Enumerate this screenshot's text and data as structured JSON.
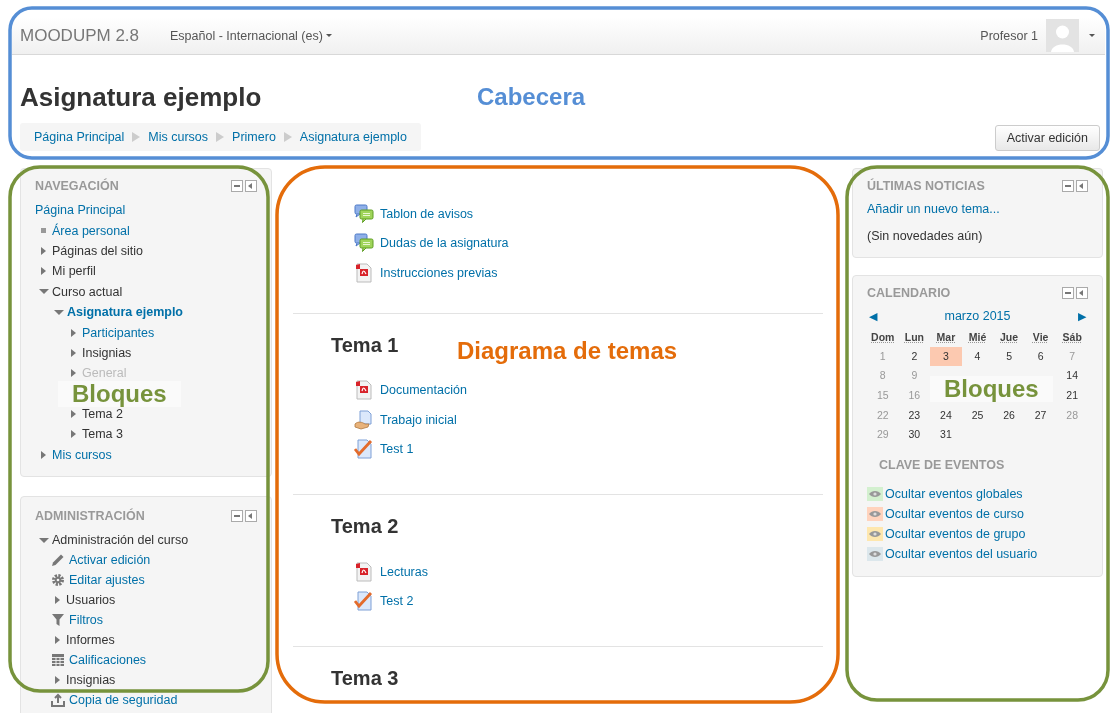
{
  "header": {
    "brand": "MOODUPM 2.8",
    "language": "Español - Internacional (es)",
    "user": "Profesor 1"
  },
  "page_title": "Asignatura ejemplo",
  "breadcrumb": [
    "Página Principal",
    "Mis cursos",
    "Primero",
    "Asignatura ejemplo"
  ],
  "edit_button": "Activar edición",
  "navigation": {
    "title": "NAVEGACIÓN",
    "items": [
      {
        "label": "Página Principal",
        "kind": "plain",
        "link": true,
        "dimmed": false,
        "current": false
      },
      {
        "label": "Área personal",
        "kind": "leaf",
        "link": true,
        "dimmed": false,
        "current": false
      },
      {
        "label": "Páginas del sitio",
        "kind": "branch",
        "expanded": false,
        "link": false,
        "dimmed": false,
        "current": false
      },
      {
        "label": "Mi perfil",
        "kind": "branch",
        "expanded": false,
        "link": false,
        "dimmed": false,
        "current": false
      },
      {
        "label": "Curso actual",
        "kind": "branch",
        "expanded": true,
        "link": false,
        "dimmed": false,
        "current": false,
        "children": [
          {
            "label": "Asignatura ejemplo",
            "kind": "branch",
            "expanded": true,
            "link": true,
            "dimmed": false,
            "current": true,
            "children": [
              {
                "label": "Participantes",
                "kind": "branch",
                "expanded": false,
                "link": true,
                "dimmed": false,
                "current": false
              },
              {
                "label": "Insignias",
                "kind": "branch",
                "expanded": false,
                "link": false,
                "dimmed": false,
                "current": false
              },
              {
                "label": "General",
                "kind": "branch",
                "expanded": false,
                "link": false,
                "dimmed": true,
                "current": false
              },
              {
                "kind": "covered"
              },
              {
                "label": "Tema 2",
                "kind": "branch",
                "expanded": false,
                "link": false,
                "dimmed": false,
                "current": false
              },
              {
                "label": "Tema 3",
                "kind": "branch",
                "expanded": false,
                "link": false,
                "dimmed": false,
                "current": false
              }
            ]
          }
        ]
      },
      {
        "label": "Mis cursos",
        "kind": "branch",
        "expanded": false,
        "link": true,
        "dimmed": false,
        "current": false
      }
    ]
  },
  "administration": {
    "title": "ADMINISTRACIÓN",
    "items": [
      {
        "label": "Administración del curso",
        "kind": "branch",
        "expanded": true,
        "link": false,
        "dimmed": false,
        "current": false,
        "children": [
          {
            "label": "Activar edición",
            "kind": "pencil",
            "link": true,
            "dimmed": false,
            "current": false
          },
          {
            "label": "Editar ajustes",
            "kind": "gear",
            "link": true,
            "dimmed": false,
            "current": false
          },
          {
            "label": "Usuarios",
            "kind": "branch",
            "expanded": false,
            "link": false,
            "dimmed": false,
            "current": false
          },
          {
            "label": "Filtros",
            "kind": "filter",
            "link": true,
            "dimmed": false,
            "current": false
          },
          {
            "label": "Informes",
            "kind": "branch",
            "expanded": false,
            "link": false,
            "dimmed": false,
            "current": false
          },
          {
            "label": "Calificaciones",
            "kind": "table",
            "link": true,
            "dimmed": false,
            "current": false
          },
          {
            "label": "Insignias",
            "kind": "branch",
            "expanded": false,
            "link": false,
            "dimmed": false,
            "current": false
          },
          {
            "label": "Copia de seguridad",
            "kind": "upload",
            "link": true,
            "dimmed": false,
            "current": false
          }
        ]
      }
    ]
  },
  "sections": [
    {
      "activities": [
        {
          "kind": "forum",
          "label": "Tablon de avisos"
        },
        {
          "kind": "forum",
          "label": "Dudas de la asignatura"
        },
        {
          "kind": "pdf",
          "label": "Instrucciones previas"
        }
      ]
    },
    {
      "title": "Tema 1",
      "activities": [
        {
          "kind": "pdf",
          "label": "Documentación"
        },
        {
          "kind": "assignment",
          "label": "Trabajo inicial"
        },
        {
          "kind": "quiz",
          "label": "Test 1"
        }
      ]
    },
    {
      "title": "Tema 2",
      "activities": [
        {
          "kind": "pdf",
          "label": "Lecturas"
        },
        {
          "kind": "quiz",
          "label": "Test 2"
        }
      ]
    },
    {
      "title": "Tema 3"
    }
  ],
  "news": {
    "title": "ÚLTIMAS NOTICIAS",
    "link": "Añadir un nuevo tema...",
    "note": "(Sin novedades aún)"
  },
  "calendar": {
    "title": "CALENDARIO",
    "prev": "◀",
    "month": "marzo 2015",
    "next": "▶",
    "weekdays": [
      "Dom",
      "Lun",
      "Mar",
      "Mié",
      "Jue",
      "Vie",
      "Sáb"
    ],
    "weeks": [
      {
        "start": [
          {
            "day": "1",
            "muted": true,
            "today": false
          },
          {
            "day": "2",
            "muted": false,
            "today": false
          },
          {
            "day": "3",
            "muted": false,
            "today": true
          },
          {
            "day": "4",
            "muted": false,
            "today": false
          },
          {
            "day": "5",
            "muted": false,
            "today": false
          },
          {
            "day": "6",
            "muted": false,
            "today": false
          },
          {
            "day": "7",
            "muted": true,
            "today": false
          }
        ]
      },
      {
        "start": [
          {
            "day": "8",
            "muted": true,
            "today": false
          },
          {
            "day": "9",
            "muted": true,
            "today": false
          }
        ],
        "end": [
          {
            "day": "14",
            "muted": false,
            "today": false
          }
        ]
      },
      {
        "start": [
          {
            "day": "15",
            "muted": true,
            "today": false
          },
          {
            "day": "16",
            "muted": true,
            "today": false
          }
        ],
        "end": [
          {
            "day": "21",
            "muted": false,
            "today": false
          }
        ]
      },
      {
        "start": [
          {
            "day": "22",
            "muted": true,
            "today": false
          },
          {
            "day": "23",
            "muted": false,
            "today": false
          },
          {
            "day": "24",
            "muted": false,
            "today": false
          },
          {
            "day": "25",
            "muted": false,
            "today": false
          },
          {
            "day": "26",
            "muted": false,
            "today": false
          },
          {
            "day": "27",
            "muted": false,
            "today": false
          },
          {
            "day": "28",
            "muted": true,
            "today": false
          }
        ]
      },
      {
        "start": [
          {
            "day": "29",
            "muted": true,
            "today": false
          },
          {
            "day": "30",
            "muted": false,
            "today": false
          },
          {
            "day": "31",
            "muted": false,
            "today": false
          }
        ]
      }
    ],
    "key_title": "CLAVE DE EVENTOS",
    "events": [
      {
        "label": "Ocultar eventos globales",
        "color": "#d3f0cf"
      },
      {
        "label": "Ocultar eventos de curso",
        "color": "#ffd3bd"
      },
      {
        "label": "Ocultar eventos de grupo",
        "color": "#fee7ae"
      },
      {
        "label": "Ocultar eventos del usuario",
        "color": "#dce7ec"
      }
    ]
  },
  "annotations": [
    {
      "kind": "header",
      "label": "Cabecera",
      "color": "#558ed5"
    },
    {
      "kind": "content",
      "label": "Diagrama de temas",
      "color": "#e46c0a"
    },
    {
      "kind": "left",
      "label": "Bloques",
      "color": "#77933c"
    },
    {
      "kind": "right",
      "label": "Bloques",
      "color": "#77933c"
    }
  ]
}
